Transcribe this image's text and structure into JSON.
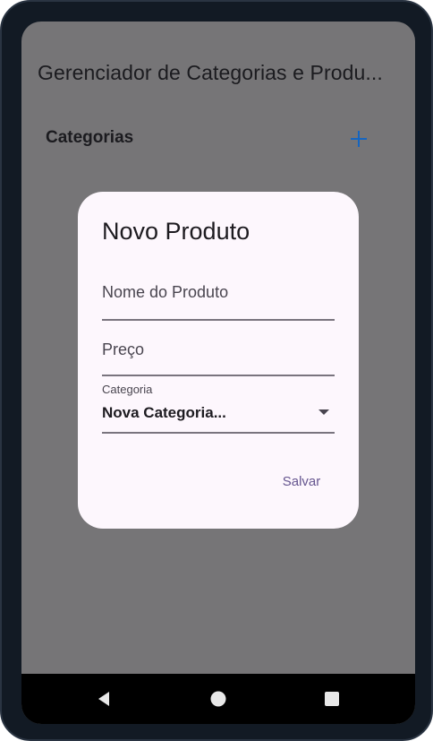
{
  "app_bar": {
    "title": "Gerenciador de Categorias e Produ..."
  },
  "section": {
    "title": "Categorias",
    "add_icon": "plus-icon"
  },
  "dialog": {
    "title": "Novo Produto",
    "name_field": {
      "placeholder": "Nome do Produto"
    },
    "price_field": {
      "placeholder": "Preço"
    },
    "category_field": {
      "label": "Categoria",
      "value": "Nova Categoria..."
    },
    "save_label": "Salvar"
  },
  "nav": {
    "back_icon": "back-triangle-icon",
    "home_icon": "home-circle-icon",
    "recents_icon": "recents-square-icon"
  },
  "colors": {
    "scrim": "#767577",
    "dialog_bg": "#fdf7fd",
    "accent": "#65558f",
    "add_icon": "#1565c0"
  }
}
